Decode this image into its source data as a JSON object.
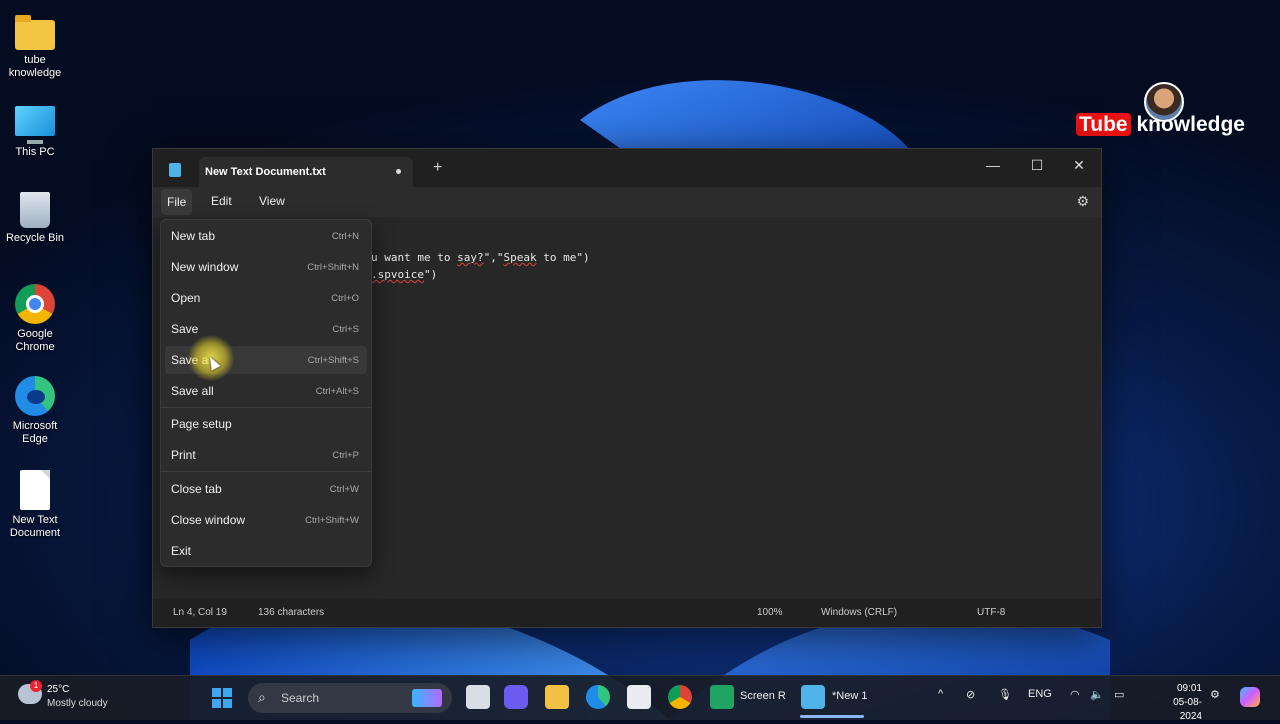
{
  "desktop": {
    "icons": [
      {
        "label": "tube knowledge",
        "icon": "folder-icon"
      },
      {
        "label": "This PC",
        "icon": "computer-icon"
      },
      {
        "label": "Recycle Bin",
        "icon": "recycle-bin-icon"
      },
      {
        "label": "Google Chrome",
        "icon": "chrome-icon"
      },
      {
        "label": "Microsoft Edge",
        "icon": "edge-icon"
      },
      {
        "label": "New Text Document",
        "icon": "text-document-icon"
      }
    ]
  },
  "watermark": {
    "brand_red": "Tube",
    "brand_white": "knowledge",
    "accent": "#e11111"
  },
  "notepad": {
    "tab_title": "New Text Document.txt",
    "new_tab_symbol": "+",
    "controls": {
      "minimize": "—",
      "maximize": "☐",
      "close": "✕"
    },
    "menus": {
      "file": "File",
      "edit": "Edit",
      "view": "View"
    },
    "code": {
      "line1_a": "u want me to ",
      "line1_squiggle": "say?",
      "line1_b": "\",\"",
      "line1_squiggle2": "Speak",
      "line1_c": " to me\")",
      "line2_squiggle": ".spvoice",
      "line2_b": "\")"
    },
    "status": {
      "position": "Ln 4, Col 19",
      "characters": "136 characters",
      "zoom": "100%",
      "line_ending": "Windows (CRLF)",
      "encoding": "UTF-8"
    },
    "file_menu": [
      {
        "label": "New tab",
        "shortcut": "Ctrl+N"
      },
      {
        "label": "New window",
        "shortcut": "Ctrl+Shift+N"
      },
      {
        "label": "Open",
        "shortcut": "Ctrl+O"
      },
      {
        "label": "Save",
        "shortcut": "Ctrl+S"
      },
      {
        "label": "Save a",
        "shortcut": "Ctrl+Shift+S"
      },
      {
        "label": "Save all",
        "shortcut": "Ctrl+Alt+S"
      },
      {
        "label": "Page setup",
        "shortcut": ""
      },
      {
        "label": "Print",
        "shortcut": "Ctrl+P"
      },
      {
        "label": "Close tab",
        "shortcut": "Ctrl+W"
      },
      {
        "label": "Close window",
        "shortcut": "Ctrl+Shift+W"
      },
      {
        "label": "Exit",
        "shortcut": ""
      }
    ]
  },
  "taskbar": {
    "weather": {
      "badge": "1",
      "temp": "25°C",
      "condition": "Mostly cloudy"
    },
    "search_placeholder": "Search",
    "apps": [
      {
        "label": "Screen R",
        "icon": "screen-recorder-icon"
      },
      {
        "label": "*New 1",
        "icon": "notepad-icon"
      }
    ],
    "tray": {
      "language": "ENG",
      "chevron": "^"
    },
    "clock": {
      "time": "09:01",
      "date": "05-08-2024"
    }
  }
}
